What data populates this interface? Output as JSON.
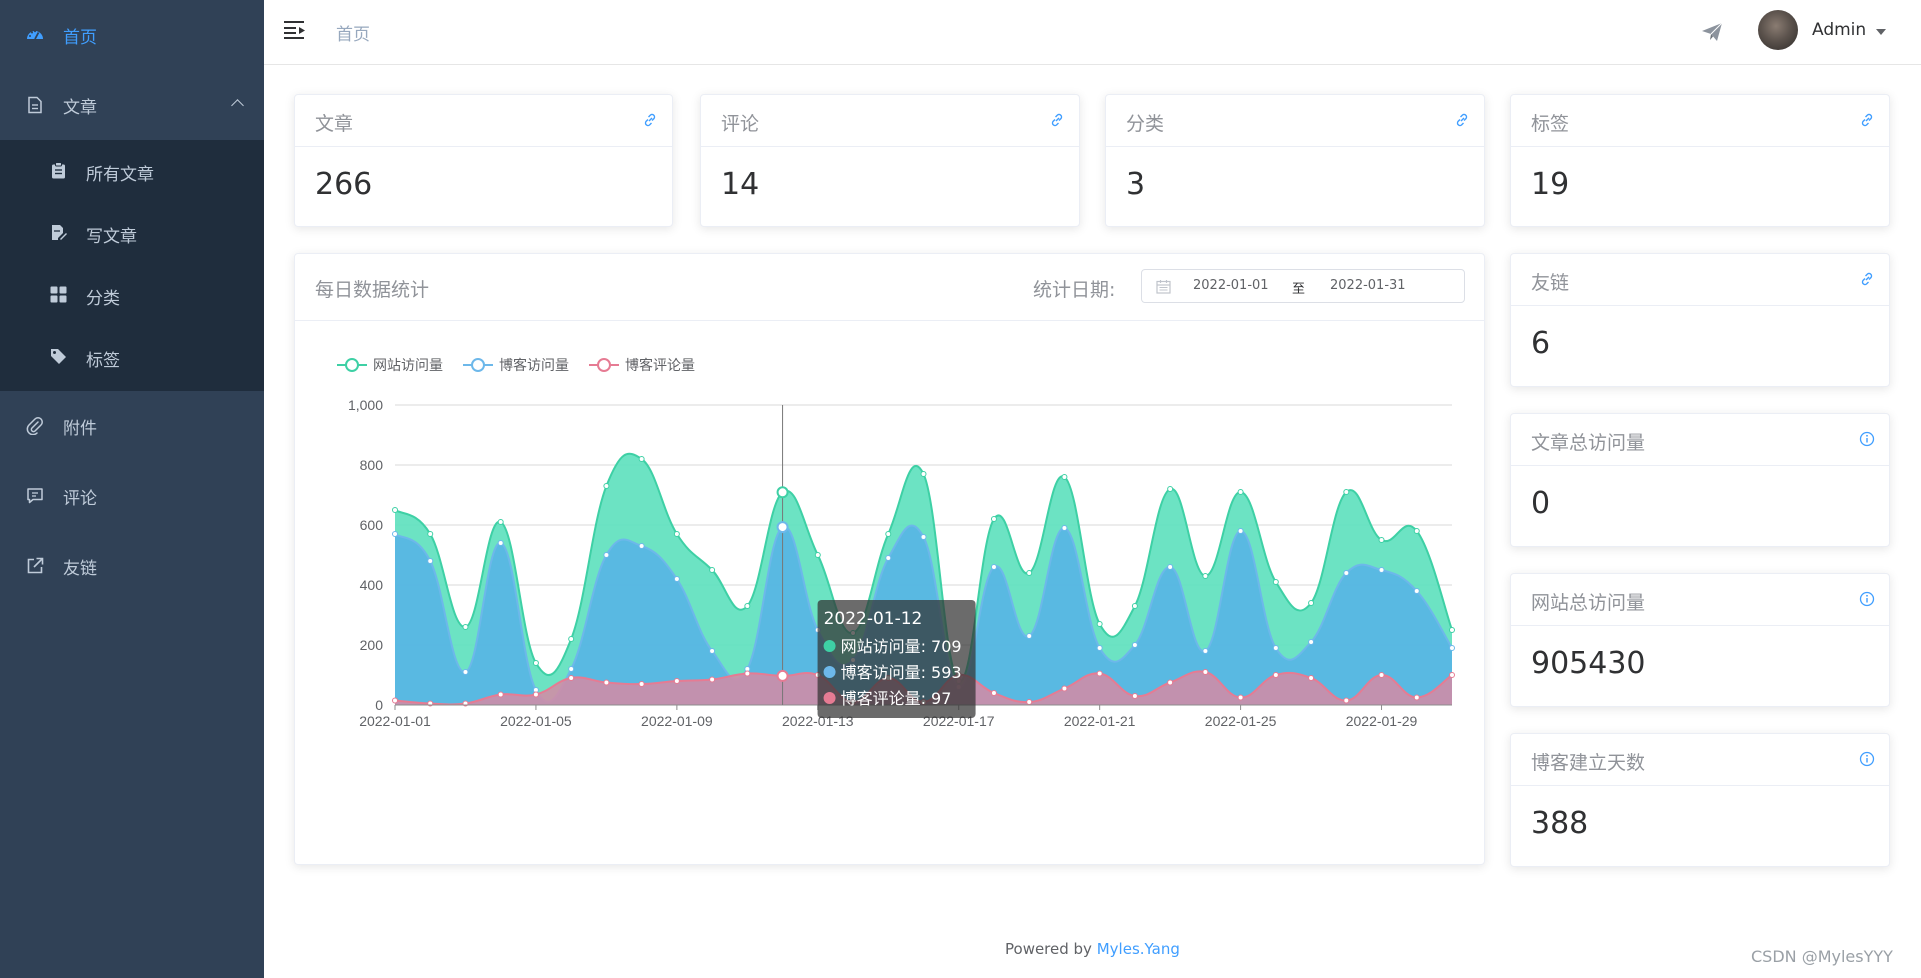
{
  "sidebar": {
    "items": [
      {
        "label": "首页",
        "icon": "dashboard-icon",
        "active": true
      },
      {
        "label": "文章",
        "icon": "document-icon",
        "expanded": true
      },
      {
        "label": "附件",
        "icon": "paperclip-icon"
      },
      {
        "label": "评论",
        "icon": "comment-icon"
      },
      {
        "label": "友链",
        "icon": "external-link-icon"
      }
    ],
    "sub_items": [
      {
        "label": "所有文章",
        "icon": "clipboard-icon"
      },
      {
        "label": "写文章",
        "icon": "edit-document-icon"
      },
      {
        "label": "分类",
        "icon": "grid-icon"
      },
      {
        "label": "标签",
        "icon": "tag-icon"
      }
    ]
  },
  "header": {
    "breadcrumb": "首页",
    "user_name": "Admin"
  },
  "stats": [
    {
      "title": "文章",
      "value": "266",
      "icon": "link-icon"
    },
    {
      "title": "评论",
      "value": "14",
      "icon": "link-icon"
    },
    {
      "title": "分类",
      "value": "3",
      "icon": "link-icon"
    },
    {
      "title": "标签",
      "value": "19",
      "icon": "link-icon"
    }
  ],
  "side_stats": [
    {
      "title": "友链",
      "value": "6",
      "icon": "link-icon"
    },
    {
      "title": "文章总访问量",
      "value": "0",
      "icon": "info-icon"
    },
    {
      "title": "网站总访问量",
      "value": "905430",
      "icon": "info-icon"
    },
    {
      "title": "博客建立天数",
      "value": "388",
      "icon": "info-icon"
    }
  ],
  "chart_panel": {
    "title": "每日数据统计",
    "date_label": "统计日期:",
    "date_start": "2022-01-01",
    "date_separator": "至",
    "date_end": "2022-01-31"
  },
  "chart_data": {
    "type": "area",
    "x": [
      "2022-01-01",
      "2022-01-02",
      "2022-01-03",
      "2022-01-04",
      "2022-01-05",
      "2022-01-06",
      "2022-01-07",
      "2022-01-08",
      "2022-01-09",
      "2022-01-10",
      "2022-01-11",
      "2022-01-12",
      "2022-01-13",
      "2022-01-14",
      "2022-01-15",
      "2022-01-16",
      "2022-01-17",
      "2022-01-18",
      "2022-01-19",
      "2022-01-20",
      "2022-01-21",
      "2022-01-22",
      "2022-01-23",
      "2022-01-24",
      "2022-01-25",
      "2022-01-26",
      "2022-01-27",
      "2022-01-28",
      "2022-01-29",
      "2022-01-30",
      "2022-01-31"
    ],
    "xticks": [
      "2022-01-01",
      "2022-01-05",
      "2022-01-09",
      "2022-01-13",
      "2022-01-17",
      "2022-01-21",
      "2022-01-25",
      "2022-01-29"
    ],
    "ylim": [
      0,
      1000
    ],
    "yticks": [
      "0",
      "200",
      "400",
      "600",
      "800",
      "1,000"
    ],
    "legend_position": "top-left",
    "grid": true,
    "series": [
      {
        "name": "网站访问量",
        "color": "#3ed0a5",
        "fill": "#5ce0bd",
        "values": [
          650,
          570,
          260,
          610,
          140,
          220,
          730,
          820,
          570,
          450,
          330,
          709,
          500,
          240,
          570,
          770,
          80,
          620,
          440,
          760,
          270,
          330,
          720,
          430,
          710,
          410,
          340,
          710,
          550,
          580,
          250
        ]
      },
      {
        "name": "博客访问量",
        "color": "#6db8ea",
        "fill": "#58b4e6",
        "values": [
          570,
          480,
          110,
          540,
          50,
          120,
          500,
          530,
          420,
          180,
          120,
          593,
          250,
          150,
          490,
          560,
          60,
          460,
          230,
          590,
          190,
          200,
          460,
          180,
          580,
          190,
          210,
          440,
          450,
          380,
          190
        ]
      },
      {
        "name": "博客评论量",
        "color": "#e67b93",
        "fill": "#d58aa5",
        "values": [
          15,
          5,
          5,
          35,
          35,
          90,
          75,
          70,
          80,
          85,
          105,
          97,
          100,
          10,
          90,
          10,
          100,
          40,
          10,
          55,
          105,
          30,
          75,
          110,
          25,
          100,
          90,
          15,
          100,
          25,
          100
        ]
      }
    ],
    "tooltip": {
      "date": "2022-01-12",
      "lines": [
        "网站访问量: 709",
        "博客访问量: 593",
        "博客评论量: 97"
      ]
    }
  },
  "footer": {
    "prefix": "Powered by",
    "author": "Myles.Yang"
  },
  "watermark": "CSDN @MylesYYY"
}
